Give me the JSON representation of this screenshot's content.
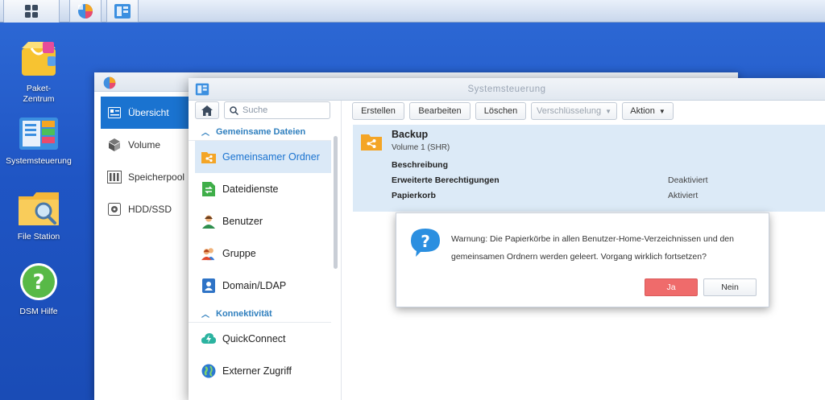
{
  "taskbar": {
    "items": [
      "main-menu",
      "storage-manager",
      "control-panel"
    ]
  },
  "desktop": {
    "icons": [
      {
        "label": "Paket-\nZentrum",
        "line1": "Paket-",
        "line2": "Zentrum"
      },
      {
        "label": "Systemsteuerung"
      },
      {
        "label": "File Station"
      },
      {
        "label": "DSM Hilfe"
      }
    ]
  },
  "storage_window": {
    "nav": [
      {
        "label": "Übersicht",
        "icon": "overview-icon",
        "active": true
      },
      {
        "label": "Volume",
        "icon": "volume-icon"
      },
      {
        "label": "Speicherpool",
        "icon": "storage-pool-icon"
      },
      {
        "label": "HDD/SSD",
        "icon": "hdd-icon"
      }
    ]
  },
  "control_panel": {
    "title": "Systemsteuerung",
    "search_placeholder": "Suche",
    "sections": [
      {
        "label": "Gemeinsame Dateien"
      },
      {
        "label": "Konnektivität"
      }
    ],
    "nav": [
      {
        "label": "Gemeinsamer Ordner",
        "icon": "shared-folder-icon",
        "active": true
      },
      {
        "label": "Dateidienste",
        "icon": "file-services-icon"
      },
      {
        "label": "Benutzer",
        "icon": "user-icon"
      },
      {
        "label": "Gruppe",
        "icon": "group-icon"
      },
      {
        "label": "Domain/LDAP",
        "icon": "domain-ldap-icon"
      },
      {
        "label": "QuickConnect",
        "icon": "quickconnect-icon"
      },
      {
        "label": "Externer Zugriff",
        "icon": "external-access-icon"
      }
    ],
    "toolbar": {
      "create": "Erstellen",
      "edit": "Bearbeiten",
      "delete": "Löschen",
      "encryption": "Verschlüsselung",
      "action": "Aktion"
    },
    "folder": {
      "name": "Backup",
      "volume": "Volume 1 (SHR)",
      "rows": [
        {
          "label": "Beschreibung",
          "value": ""
        },
        {
          "label": "Erweiterte Berechtigungen",
          "value": "Deaktiviert"
        },
        {
          "label": "Papierkorb",
          "value": "Aktiviert"
        }
      ]
    }
  },
  "dialog": {
    "line1": "Warnung: Die Papierkörbe in allen Benutzer-Home-Verzeichnissen und den",
    "line2": "gemeinsamen Ordnern werden geleert. Vorgang wirklich fortsetzen?",
    "yes": "Ja",
    "no": "Nein"
  },
  "colors": {
    "accent": "#1a73d0",
    "selected_bg": "#dbe9f7",
    "danger": "#ef6b6b",
    "desktop": "#1f55c4"
  }
}
